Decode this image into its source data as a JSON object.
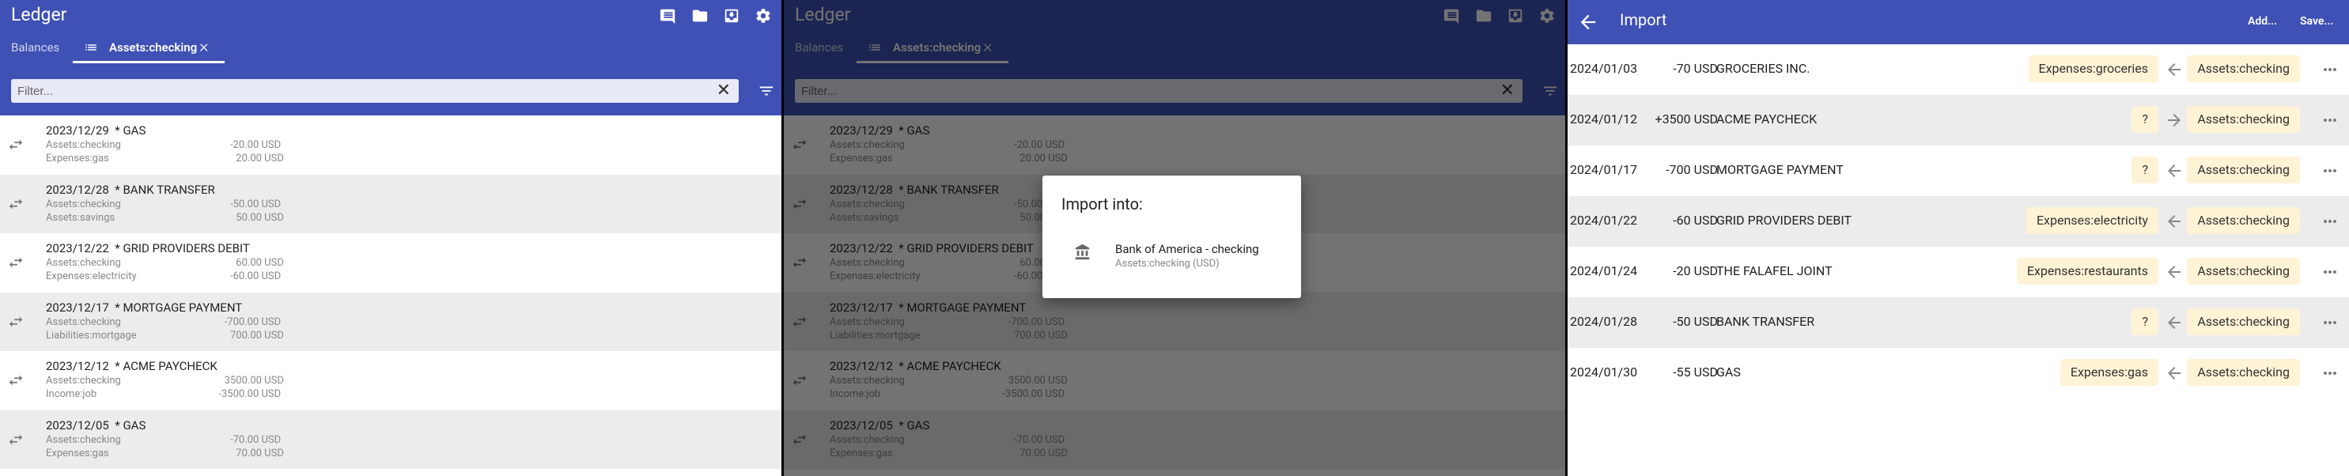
{
  "ledger": {
    "app_title": "Ledger",
    "tabs": [
      "Balances",
      "Assets:checking"
    ],
    "filter_placeholder": "Filter...",
    "clear_glyph": "✕",
    "tab_close_glyph": "×",
    "header_icons": [
      "comment-icon",
      "folder-icon",
      "download-icon",
      "settings-icon"
    ],
    "transactions": [
      {
        "title": "2023/12/29  * GAS",
        "postings": [
          {
            "account": "Assets:checking",
            "amount": "-20.00 USD"
          },
          {
            "account": "Expenses:gas",
            "amount": "20.00 USD"
          }
        ]
      },
      {
        "title": "2023/12/28  * BANK TRANSFER",
        "postings": [
          {
            "account": "Assets:checking",
            "amount": "-50.00 USD"
          },
          {
            "account": "Assets:savings",
            "amount": "50.00 USD"
          }
        ]
      },
      {
        "title": "2023/12/22  * GRID PROVIDERS DEBIT",
        "postings": [
          {
            "account": "Assets:checking",
            "amount": "60.00 USD"
          },
          {
            "account": "Expenses:electricity",
            "amount": "-60.00 USD"
          }
        ]
      },
      {
        "title": "2023/12/17  * MORTGAGE PAYMENT",
        "postings": [
          {
            "account": "Assets:checking",
            "amount": "-700.00 USD"
          },
          {
            "account": "Liabilities:mortgage",
            "amount": "700.00 USD"
          }
        ]
      },
      {
        "title": "2023/12/12  * ACME PAYCHECK",
        "postings": [
          {
            "account": "Assets:checking",
            "amount": "3500.00 USD"
          },
          {
            "account": "Income:job",
            "amount": "-3500.00 USD"
          }
        ]
      },
      {
        "title": "2023/12/05  * GAS",
        "postings": [
          {
            "account": "Assets:checking",
            "amount": "-70.00 USD"
          },
          {
            "account": "Expenses:gas",
            "amount": "70.00 USD"
          }
        ]
      }
    ]
  },
  "dialog": {
    "title": "Import into:",
    "item_name": "Bank of America - checking",
    "item_sub": "Assets:checking (USD)"
  },
  "import": {
    "title": "Import",
    "add_label": "Add...",
    "save_label": "Save...",
    "rows": [
      {
        "date": "2024/01/03",
        "amount": "-70 USD",
        "desc": "GROCERIES INC.",
        "category": "Expenses:groceries",
        "account": "Assets:checking",
        "arrow": "left"
      },
      {
        "date": "2024/01/12",
        "amount": "+3500 USD",
        "desc": "ACME PAYCHECK",
        "category": "?",
        "account": "Assets:checking",
        "arrow": "right"
      },
      {
        "date": "2024/01/17",
        "amount": "-700 USD",
        "desc": "MORTGAGE PAYMENT",
        "category": "?",
        "account": "Assets:checking",
        "arrow": "left"
      },
      {
        "date": "2024/01/22",
        "amount": "-60 USD",
        "desc": "GRID PROVIDERS DEBIT",
        "category": "Expenses:electricity",
        "account": "Assets:checking",
        "arrow": "left"
      },
      {
        "date": "2024/01/24",
        "amount": "-20 USD",
        "desc": "THE FALAFEL JOINT",
        "category": "Expenses:restaurants",
        "account": "Assets:checking",
        "arrow": "left"
      },
      {
        "date": "2024/01/28",
        "amount": "-50 USD",
        "desc": "BANK TRANSFER",
        "category": "?",
        "account": "Assets:checking",
        "arrow": "left"
      },
      {
        "date": "2024/01/30",
        "amount": "-55 USD",
        "desc": "GAS",
        "category": "Expenses:gas",
        "account": "Assets:checking",
        "arrow": "left"
      }
    ]
  }
}
